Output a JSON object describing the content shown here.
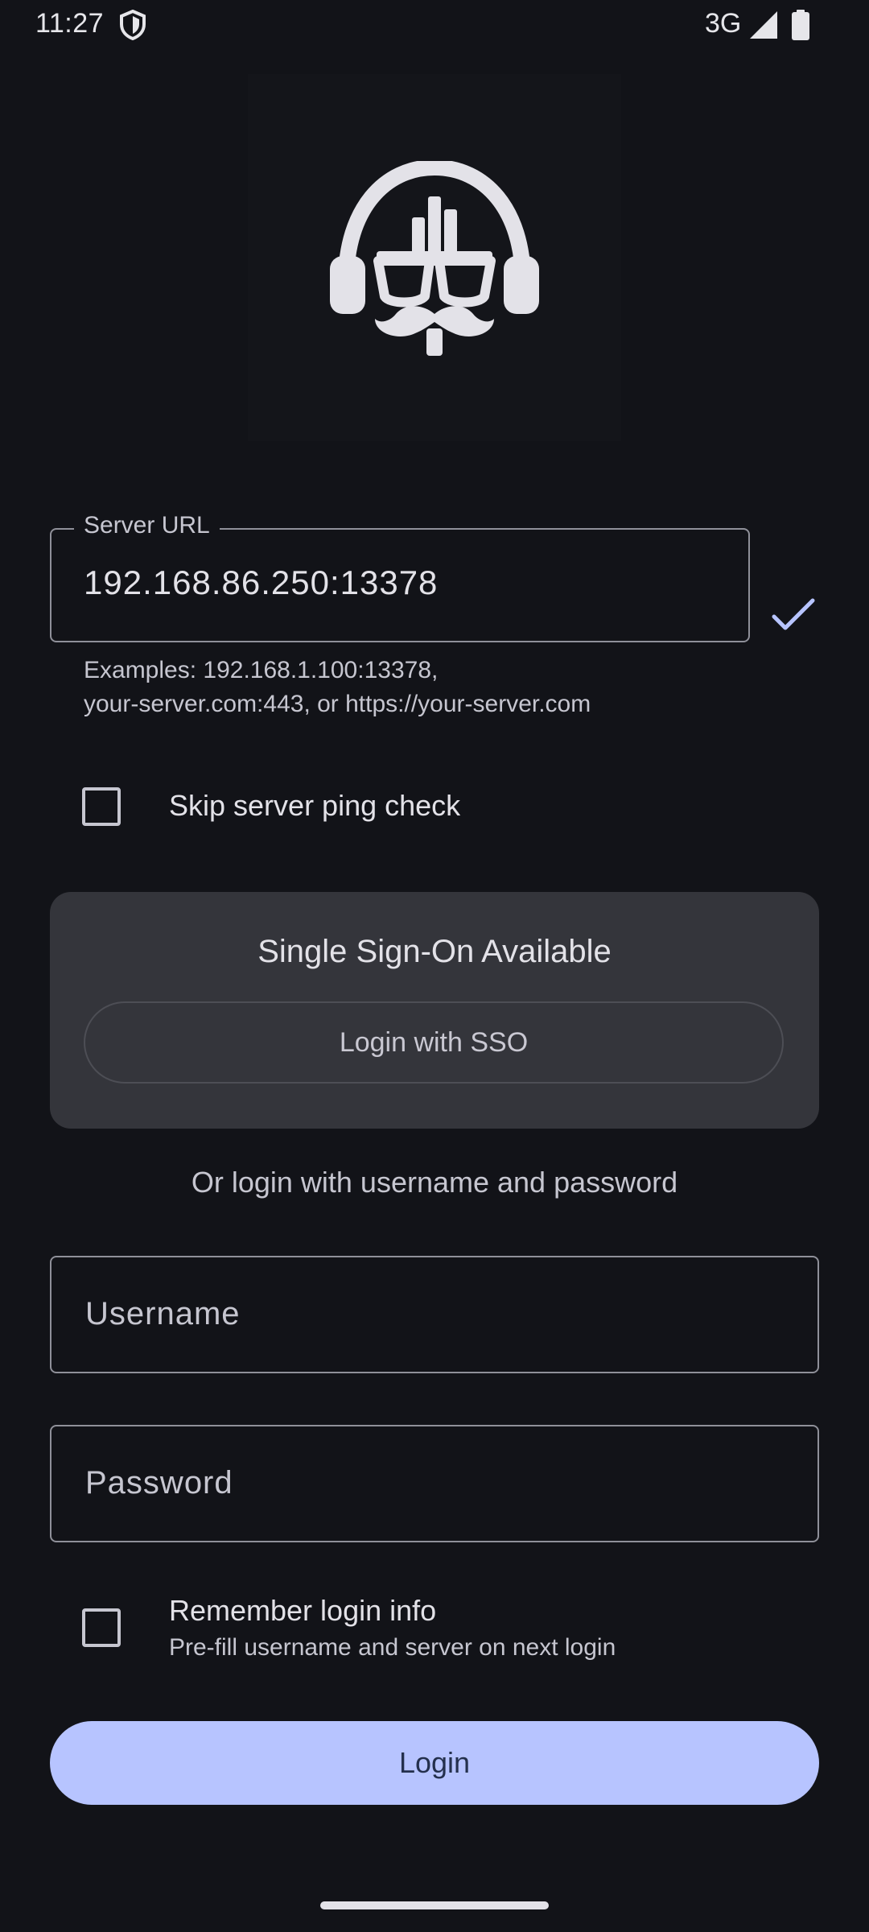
{
  "status_bar": {
    "time": "11:27",
    "network": "3G",
    "icons": [
      "shield-icon",
      "signal-icon",
      "battery-icon"
    ]
  },
  "logo": {
    "icon": "headphones-mustache-logo"
  },
  "server": {
    "label": "Server URL",
    "value": "192.168.86.250:13378",
    "helper": "Examples: 192.168.1.100:13378,\nyour-server.com:443, or https://your-server.com",
    "status_icon": "check-icon"
  },
  "skip_ping": {
    "label": "Skip server ping check",
    "checked": false
  },
  "sso": {
    "title": "Single Sign-On Available",
    "button_label": "Login with SSO"
  },
  "divider_text": "Or login with username and password",
  "username": {
    "placeholder": "Username",
    "value": ""
  },
  "password": {
    "placeholder": "Password",
    "value": ""
  },
  "remember": {
    "title": "Remember login info",
    "subtitle": "Pre-fill username and server on next login",
    "checked": false
  },
  "login_button": {
    "label": "Login"
  },
  "colors": {
    "background": "#121318",
    "accent": "#b7c4ff",
    "card": "#34353b",
    "outline": "#8f9099"
  }
}
